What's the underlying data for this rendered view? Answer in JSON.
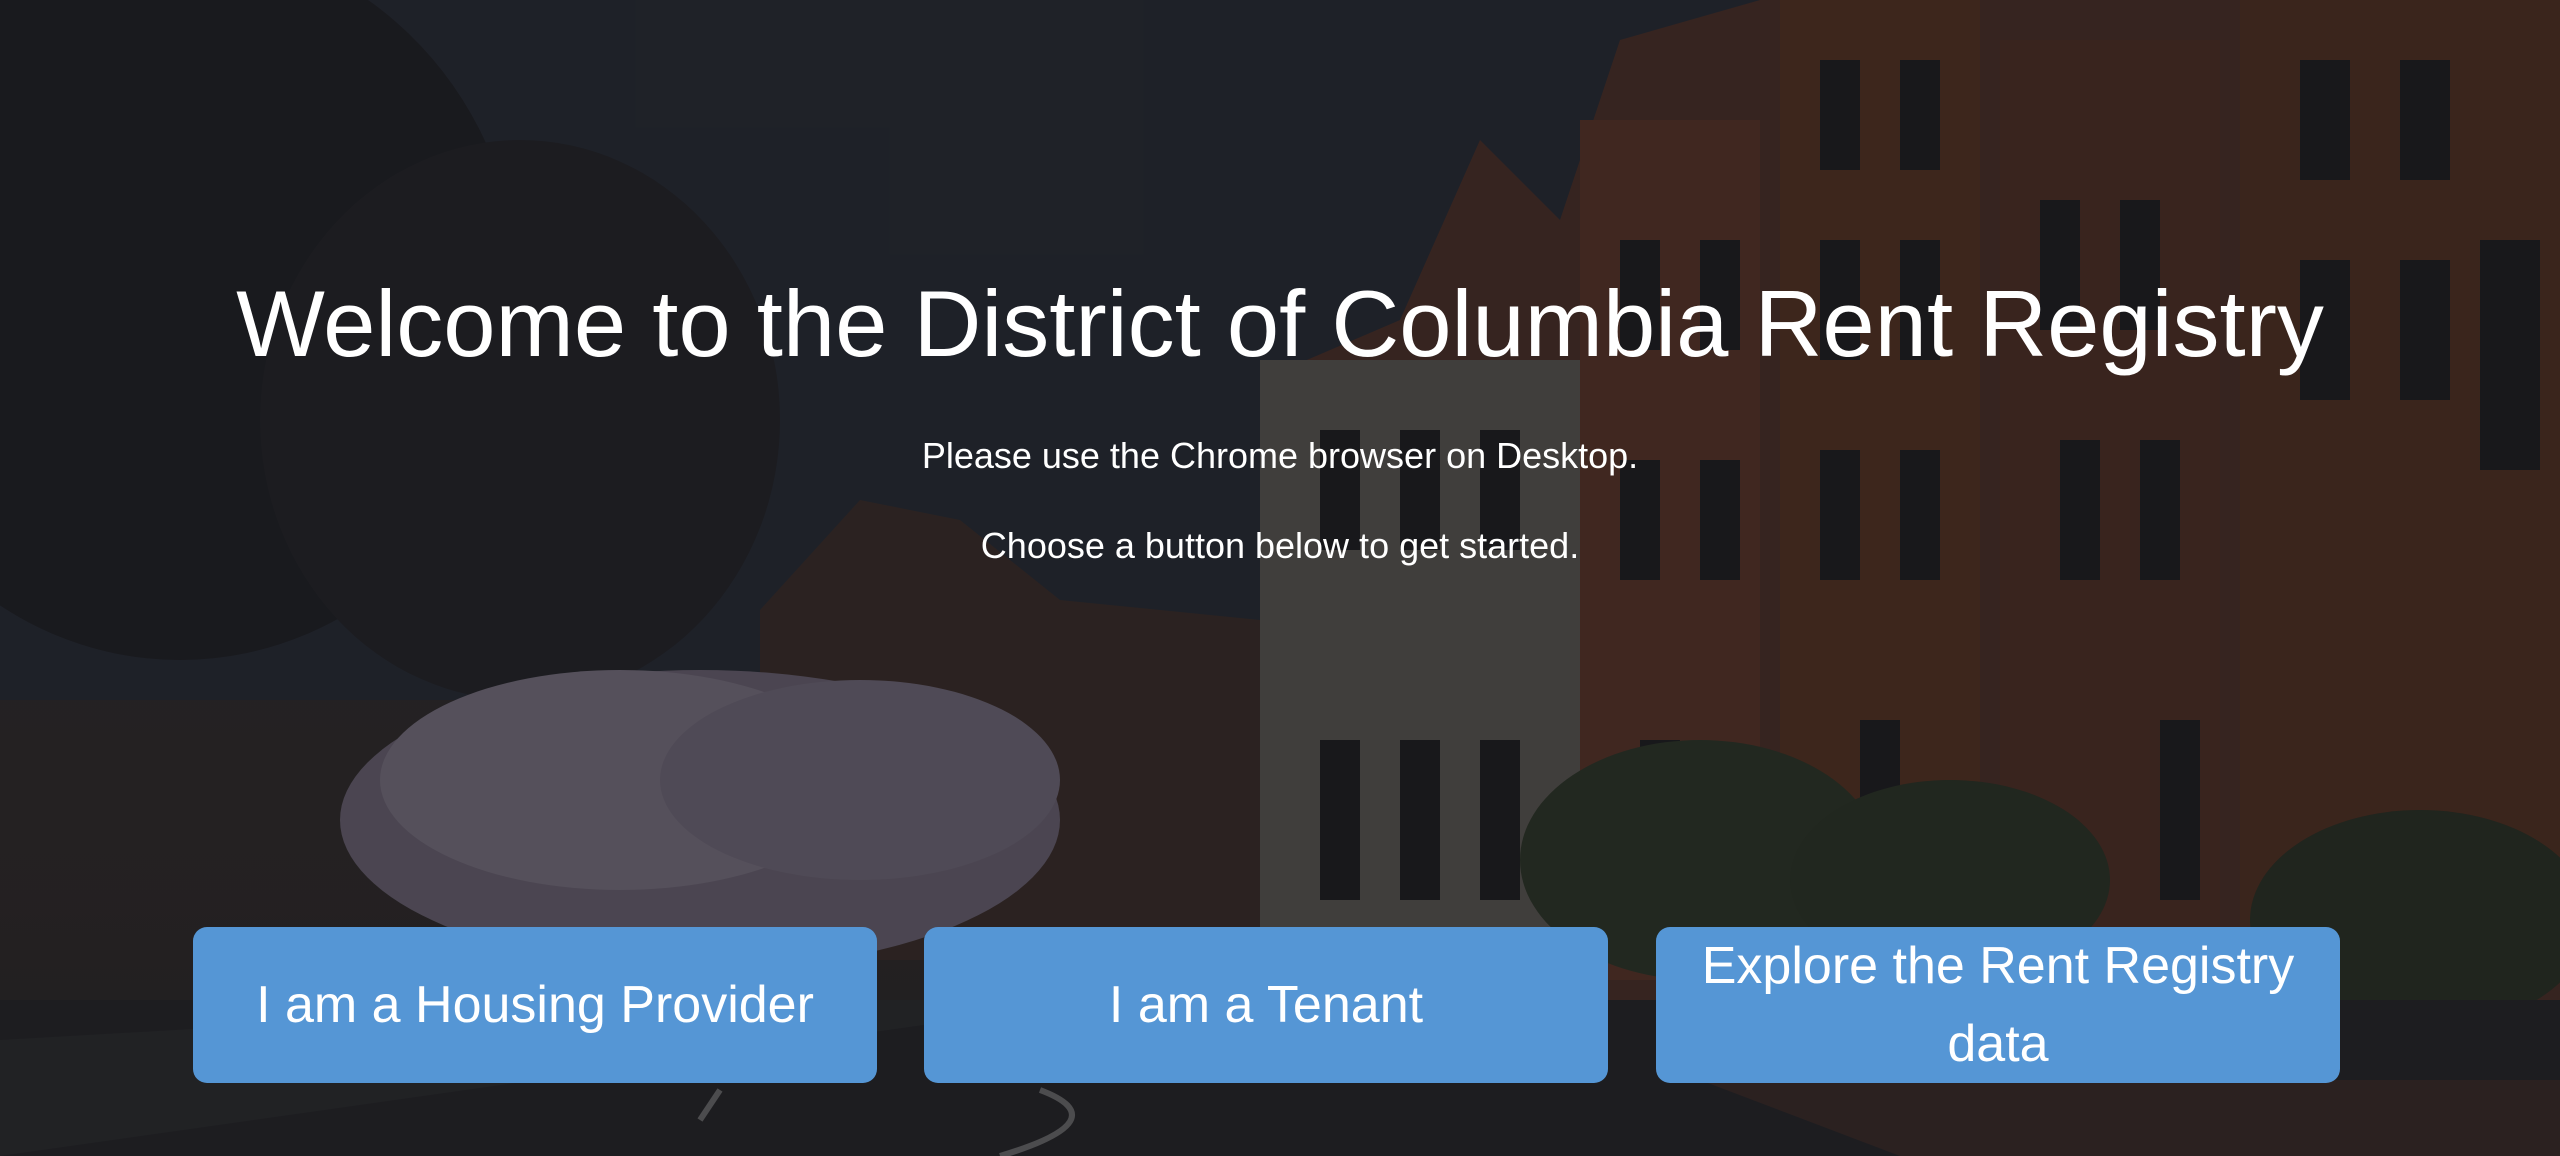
{
  "hero": {
    "title": "Welcome to the District of Columbia Rent Registry",
    "subtitle_browser": "Please use the Chrome browser on Desktop.",
    "subtitle_start": "Choose a button below to get started."
  },
  "actions": {
    "housing_provider_label": "I am a Housing Provider",
    "tenant_label": "I am a Tenant",
    "explore_label": "Explore the Rent Registry data"
  },
  "colors": {
    "button_background": "#5596d5",
    "text": "#ffffff",
    "overlay": "#121216"
  }
}
